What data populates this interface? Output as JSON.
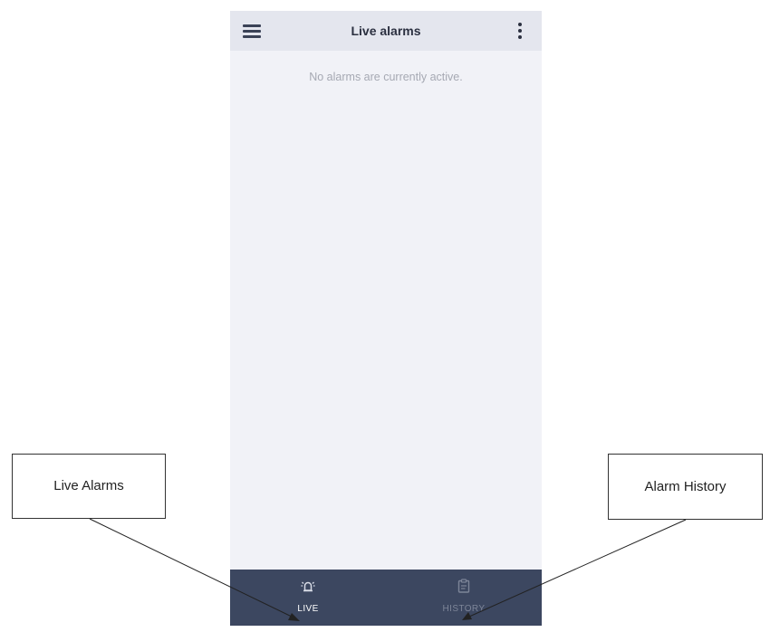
{
  "app_bar": {
    "title": "Live alarms",
    "menu_icon": "hamburger-menu-icon",
    "more_icon": "more-vert-icon"
  },
  "content": {
    "empty_message": "No alarms are currently active."
  },
  "bottom_nav": {
    "items": [
      {
        "label": "LIVE",
        "icon": "alarm-bell-icon",
        "active": true
      },
      {
        "label": "HISTORY",
        "icon": "clipboard-history-icon",
        "active": false
      }
    ]
  },
  "annotations": {
    "live_callout": "Live Alarms",
    "history_callout": "Alarm History"
  },
  "colors": {
    "app_bar_bg": "#e4e6ee",
    "screen_bg": "#f1f2f7",
    "bottom_nav_bg": "#3c4760",
    "active_label": "#ffffff",
    "inactive_label": "#7d8598"
  }
}
